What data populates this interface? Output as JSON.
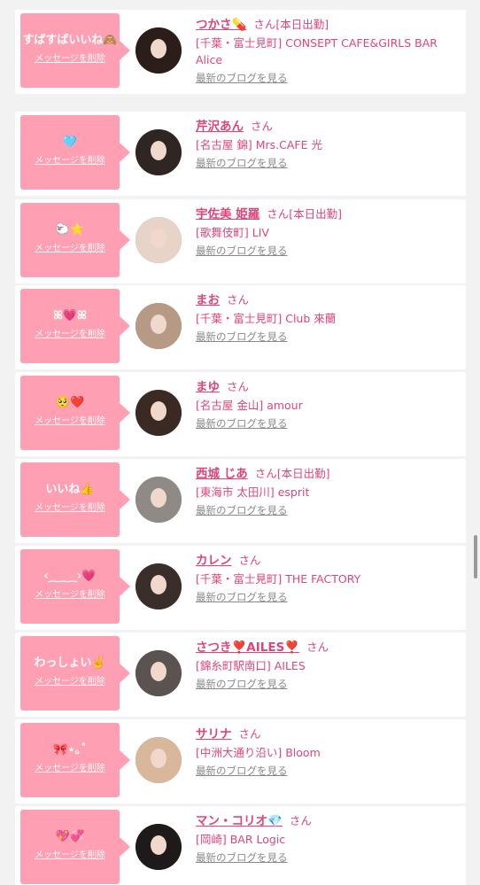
{
  "delete_label": "メッセージを削除",
  "blog_label": "最新のブログを見る",
  "san_label": "さん",
  "accent_color": "#ff9fb3",
  "name_color": "#e0457a",
  "entries": [
    {
      "message": "すばすばいいね🙈",
      "name": "つかさ💊",
      "status": "[本日出勤]",
      "shop": "[千葉・富士見町] CONSEPT CAFE&GIRLS BAR Alice"
    },
    {
      "message": "🩵",
      "name": "芹沢あん",
      "status": "",
      "shop": "[名古屋 錦] Mrs.CAFE 光"
    },
    {
      "message": "🐑⭐",
      "name": "宇佐美 姫羅",
      "status": "[本日出勤]",
      "shop": "[歌舞伎町] LIV"
    },
    {
      "message": "ꕤ💗ꕤ",
      "name": "まお",
      "status": "",
      "shop": "[千葉・富士見町] Club 來蘭"
    },
    {
      "message": "🥺❤️",
      "name": "まゆ",
      "status": "",
      "shop": "[名古屋 金山] amour"
    },
    {
      "message": "いいね👍",
      "name": "西城 じあ",
      "status": "[本日出勤]",
      "shop": "[東海市 太田川] esprit"
    },
    {
      "message": "‹⁔︎⁔︎⁔︎›💗",
      "name": "カレン",
      "status": "",
      "shop": "[千葉・富士見町] THE FACTORY"
    },
    {
      "message": "わっしょい✌️",
      "name": "さつき❣️AILES❣️",
      "status": "",
      "shop": "[錦糸町駅南口] AILES"
    },
    {
      "message": "🎀⋆｡˚",
      "name": "サリナ",
      "status": "",
      "shop": "[中洲大通り沿い] Bloom"
    },
    {
      "message": "💖💞",
      "name": "マン・コリオ💎",
      "status": "",
      "shop": "[岡崎] BAR Logic"
    }
  ]
}
